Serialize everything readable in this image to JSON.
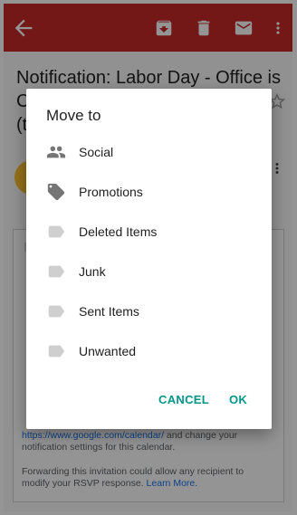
{
  "toolbar": {
    "color": "#c62828",
    "icons": [
      "back-arrow-icon",
      "archive-icon",
      "delete-icon",
      "mail-icon",
      "more-vert-icon"
    ]
  },
  "email": {
    "subject_line1": "Notification: Labor Day - Office is",
    "subject_line2": "C",
    "subject_line3": "(t",
    "footer_link": "https://www.google.com/calendar/",
    "footer_after_link": "and change your",
    "footer_line2": "notification settings for this calendar.",
    "forward_text": "Forwarding this invitation could allow any recipient to modify your RSVP response.",
    "learn_more": "Learn More."
  },
  "dialog": {
    "title": "Move to",
    "options": [
      {
        "label": "Social",
        "icon": "people-icon"
      },
      {
        "label": "Promotions",
        "icon": "tag-icon"
      },
      {
        "label": "Deleted Items",
        "icon": "label-icon"
      },
      {
        "label": "Junk",
        "icon": "label-icon"
      },
      {
        "label": "Sent Items",
        "icon": "label-icon"
      },
      {
        "label": "Unwanted",
        "icon": "label-icon"
      }
    ],
    "cancel_label": "CANCEL",
    "ok_label": "OK",
    "accent": "#009688"
  }
}
